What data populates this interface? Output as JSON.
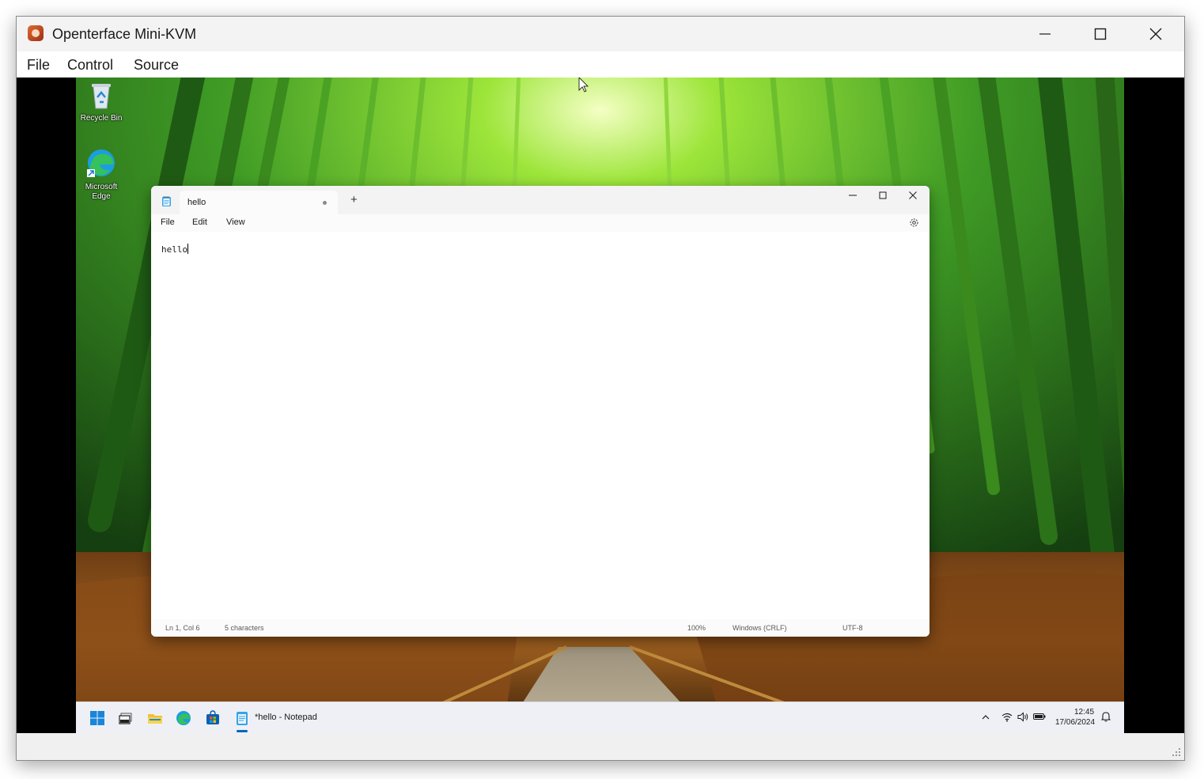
{
  "window": {
    "title": "Openterface Mini-KVM"
  },
  "menu": [
    "File",
    "Control",
    "Source"
  ],
  "desktop": {
    "icons": [
      {
        "label": "Recycle Bin"
      },
      {
        "label": "Microsoft Edge"
      }
    ]
  },
  "notepad": {
    "tab_title": "hello",
    "menu": [
      "File",
      "Edit",
      "View"
    ],
    "content": "hello",
    "status": {
      "position": "Ln 1, Col 6",
      "characters": "5 characters",
      "zoom": "100%",
      "line_ending": "Windows (CRLF)",
      "encoding": "UTF-8"
    }
  },
  "taskbar": {
    "active_app_label": "*hello - Notepad",
    "time": "12:45",
    "date": "17/06/2024"
  },
  "colors": {
    "accent": "#0067c0",
    "wallpaper_green": "#3fa127"
  }
}
